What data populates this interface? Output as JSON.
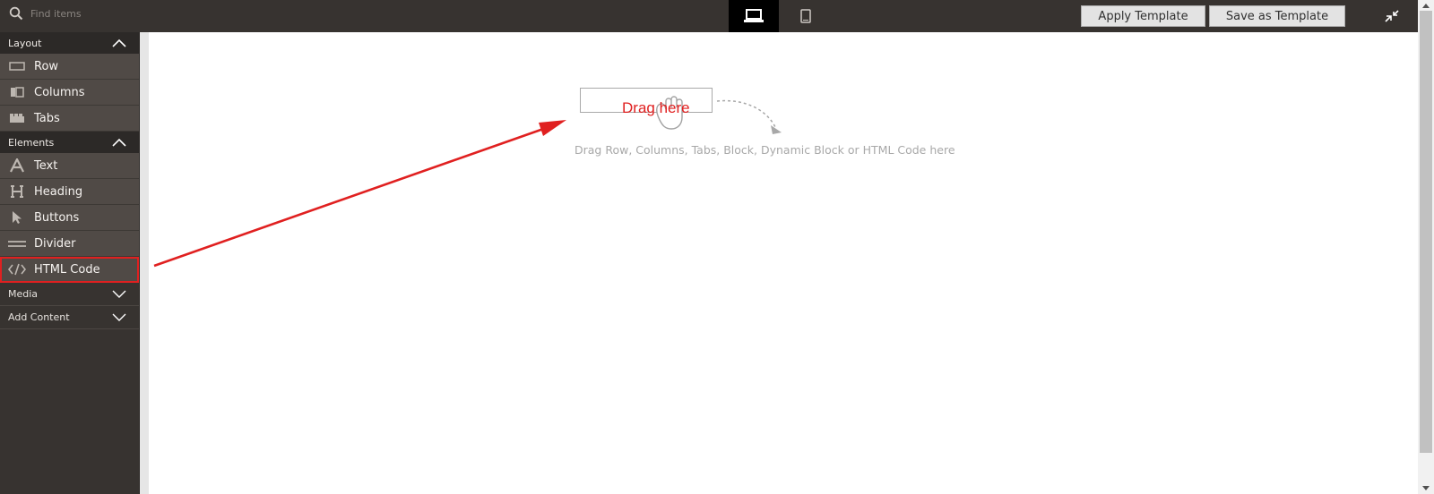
{
  "search": {
    "placeholder": "Find items"
  },
  "toolbar": {
    "apply_template_label": "Apply Template",
    "save_template_label": "Save as Template"
  },
  "sidebar": {
    "groups": [
      {
        "label": "Layout",
        "expanded": true,
        "items": [
          {
            "label": "Row",
            "icon": "row-icon"
          },
          {
            "label": "Columns",
            "icon": "columns-icon"
          },
          {
            "label": "Tabs",
            "icon": "tabs-icon"
          }
        ]
      },
      {
        "label": "Elements",
        "expanded": true,
        "items": [
          {
            "label": "Text",
            "icon": "text-icon"
          },
          {
            "label": "Heading",
            "icon": "heading-icon"
          },
          {
            "label": "Buttons",
            "icon": "cursor-icon"
          },
          {
            "label": "Divider",
            "icon": "divider-icon"
          },
          {
            "label": "HTML Code",
            "icon": "code-icon"
          }
        ]
      },
      {
        "label": "Media",
        "expanded": false
      },
      {
        "label": "Add Content",
        "expanded": false
      }
    ]
  },
  "stage": {
    "drag_here_label": "Drag here",
    "drop_hint": "Drag Row, Columns, Tabs, Block, Dynamic Block or HTML Code here"
  },
  "colors": {
    "toolbar_bg": "#373330",
    "sidebar_item_bg": "#504a46",
    "sidebar_group_bg": "#2c2927",
    "annotation_red": "#e02020",
    "active_device_bg": "#000000"
  }
}
